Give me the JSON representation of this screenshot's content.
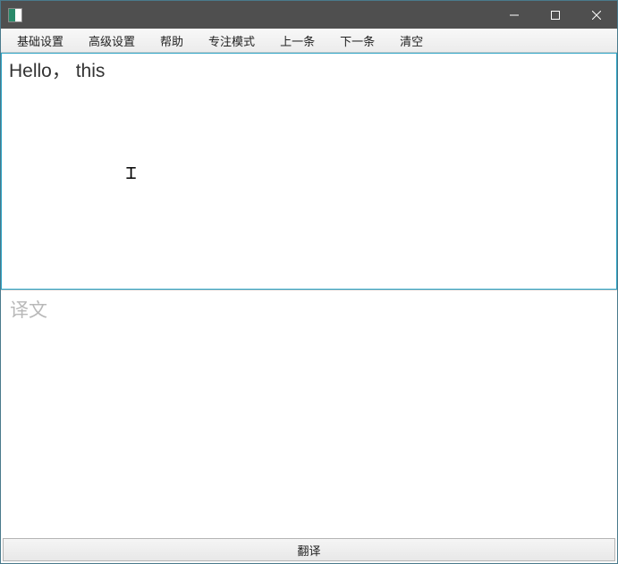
{
  "window": {
    "title": ""
  },
  "menu": {
    "items": [
      "基础设置",
      "高级设置",
      "帮助",
      "专注模式",
      "上一条",
      "下一条",
      "清空"
    ]
  },
  "source": {
    "text": "Hello， this"
  },
  "target": {
    "placeholder": "译文"
  },
  "actions": {
    "translate": "翻译"
  }
}
